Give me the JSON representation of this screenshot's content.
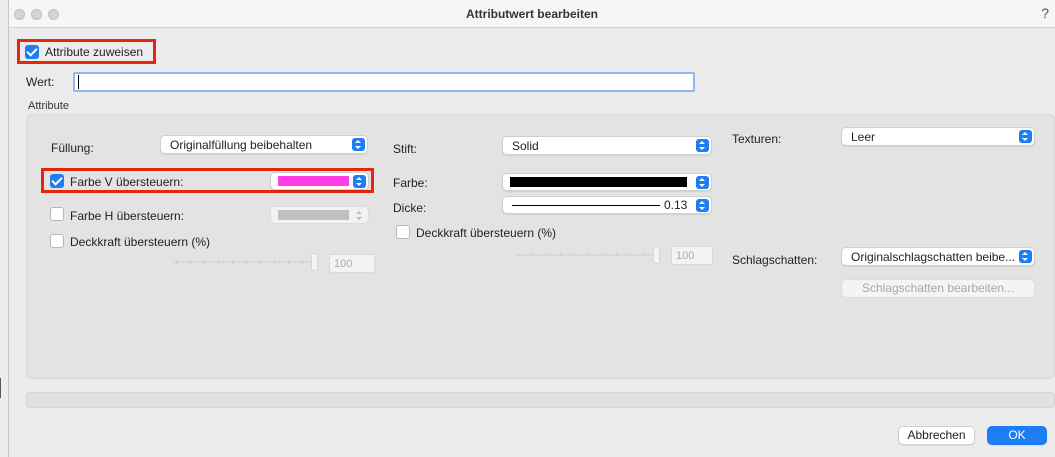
{
  "window": {
    "title": "Attributwert bearbeiten",
    "help": "?"
  },
  "assign_attributes": {
    "label": "Attribute zuweisen",
    "checked": true
  },
  "value_field": {
    "label": "Wert:",
    "value": ""
  },
  "attributes_section": {
    "label": "Attribute"
  },
  "fill": {
    "label": "Füllung:",
    "selected": "Originalfüllung beibehalten",
    "override_fg": {
      "label": "Farbe V übersteuern:",
      "checked": true,
      "color": "#ff3ee6"
    },
    "override_bg": {
      "label": "Farbe H übersteuern:",
      "checked": false,
      "color": "#c0c0c0"
    },
    "opacity": {
      "label": "Deckkraft übersteuern (%)",
      "checked": false,
      "value": "100"
    }
  },
  "pen": {
    "label": "Stift:",
    "selected": "Solid",
    "color_label": "Farbe:",
    "color": "#000000",
    "thickness_label": "Dicke:",
    "thickness": "0.13",
    "opacity": {
      "label": "Deckkraft übersteuern (%)",
      "checked": false,
      "value": "100"
    }
  },
  "textures": {
    "label": "Texturen:",
    "selected": "Leer"
  },
  "shadow": {
    "label": "Schlagschatten:",
    "selected": "Originalschlagschatten beibe...",
    "edit_button": "Schlagschatten bearbeiten..."
  },
  "buttons": {
    "cancel": "Abbrechen",
    "ok": "OK"
  },
  "colors": {
    "accent": "#1d7df5",
    "highlight": "#e4270c"
  }
}
